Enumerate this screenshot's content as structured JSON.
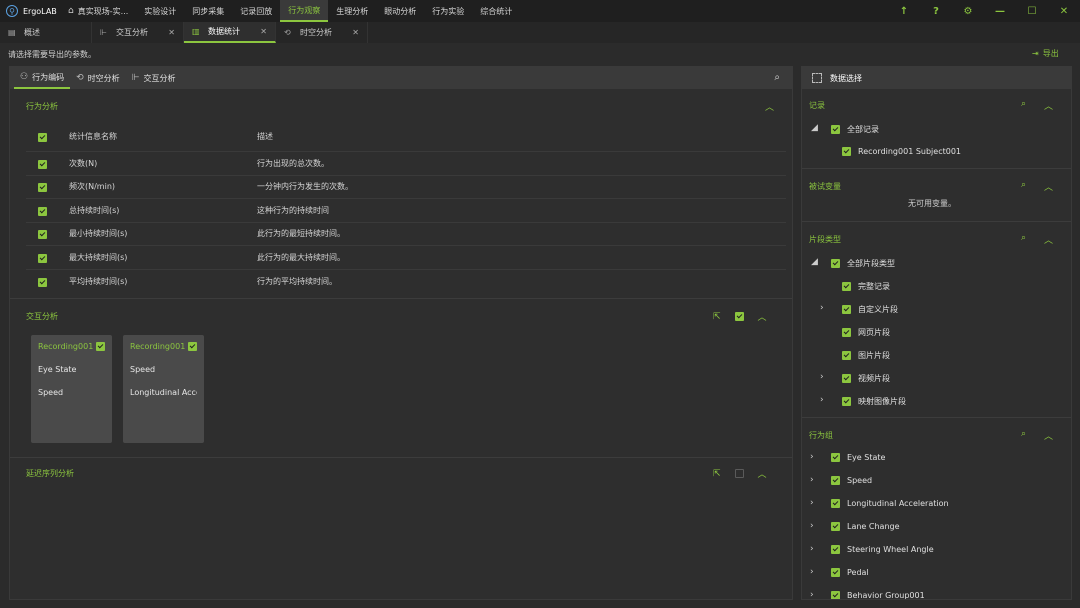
{
  "app": {
    "name": "ErgoLAB"
  },
  "menu": [
    {
      "label": "真实现场-实...",
      "active": false
    },
    {
      "label": "实验设计",
      "active": false
    },
    {
      "label": "同步采集",
      "active": false
    },
    {
      "label": "记录回放",
      "active": false
    },
    {
      "label": "行为观察",
      "active": true
    },
    {
      "label": "生理分析",
      "active": false
    },
    {
      "label": "眼动分析",
      "active": false
    },
    {
      "label": "行为实验",
      "active": false
    },
    {
      "label": "综合统计",
      "active": false
    }
  ],
  "doc_tabs": [
    {
      "label": "概述",
      "icon": "overview-icon",
      "closable": false,
      "active": false
    },
    {
      "label": "交互分析",
      "icon": "interaction-icon",
      "closable": true,
      "active": false
    },
    {
      "label": "数据统计",
      "icon": "bar-chart-icon",
      "closable": true,
      "active": true
    },
    {
      "label": "时空分析",
      "icon": "spacetime-icon",
      "closable": true,
      "active": false
    }
  ],
  "hint": "请选择需要导出的参数。",
  "export_label": "导出",
  "left_tabs": [
    {
      "label": "行为编码",
      "active": true
    },
    {
      "label": "时空分析",
      "active": false
    },
    {
      "label": "交互分析",
      "active": false
    }
  ],
  "behavior_analysis": {
    "title": "行为分析",
    "header": {
      "name": "统计信息名称",
      "desc": "描述"
    },
    "rows": [
      {
        "name": "次数(N)",
        "desc": "行为出现的总次数。"
      },
      {
        "name": "频次(N/min)",
        "desc": "一分钟内行为发生的次数。"
      },
      {
        "name": "总持续时间(s)",
        "desc": "这种行为的持续时间"
      },
      {
        "name": "最小持续时间(s)",
        "desc": "此行为的最短持续时间。"
      },
      {
        "name": "最大持续时间(s)",
        "desc": "此行为的最大持续时间。"
      },
      {
        "name": "平均持续时间(s)",
        "desc": "行为的平均持续时间。"
      }
    ]
  },
  "interaction_analysis": {
    "title": "交互分析",
    "cards": [
      {
        "title": "Recording001",
        "values": [
          "Eye State",
          "Speed"
        ]
      },
      {
        "title": "Recording001",
        "values": [
          "Speed",
          "Longitudinal Acce"
        ]
      }
    ]
  },
  "lag_analysis": {
    "title": "延迟序列分析"
  },
  "data_select": {
    "title": "数据选择",
    "records": {
      "title": "记录",
      "all": "全部记录",
      "item": "Recording001  Subject001"
    },
    "variables": {
      "title": "被试变量",
      "empty": "无可用变量。"
    },
    "segment_types": {
      "title": "片段类型",
      "all": "全部片段类型",
      "items": [
        {
          "label": "完整记录",
          "expandable": false
        },
        {
          "label": "自定义片段",
          "expandable": true
        },
        {
          "label": "网页片段",
          "expandable": false
        },
        {
          "label": "图片片段",
          "expandable": false
        },
        {
          "label": "视频片段",
          "expandable": true
        },
        {
          "label": "映射图像片段",
          "expandable": true
        }
      ]
    },
    "behavior_groups": {
      "title": "行为组",
      "items": [
        "Eye State",
        "Speed",
        "Longitudinal Acceleration",
        "Lane Change",
        "Steering Wheel Angle",
        "Pedal",
        "Behavior Group001"
      ]
    }
  }
}
